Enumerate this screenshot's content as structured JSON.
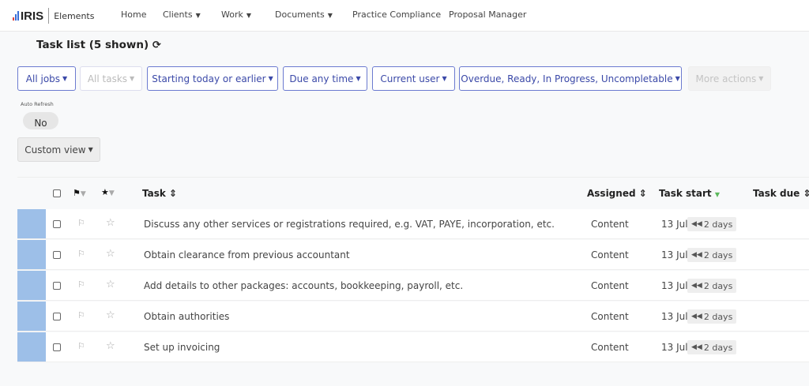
{
  "app": {
    "logo": "IRIS",
    "product": "Elements"
  },
  "nav": {
    "items": [
      {
        "label": "Home",
        "dropdown": false
      },
      {
        "label": "Clients",
        "dropdown": true
      },
      {
        "label": "Work",
        "dropdown": true
      },
      {
        "label": "Documents",
        "dropdown": true
      },
      {
        "label": "Practice Compliance",
        "dropdown": false
      },
      {
        "label": "Proposal Manager",
        "dropdown": false
      }
    ]
  },
  "page": {
    "title": "Task list (5 shown)"
  },
  "filters": [
    {
      "label": "All jobs",
      "state": "active"
    },
    {
      "label": "All tasks",
      "state": "disabled"
    },
    {
      "label": "Starting today or earlier",
      "state": "active"
    },
    {
      "label": "Due any time",
      "state": "active"
    },
    {
      "label": "Current user",
      "state": "active"
    },
    {
      "label": "Overdue, Ready, In Progress, Uncompletable",
      "state": "active"
    },
    {
      "label": "More actions",
      "state": "disabled"
    }
  ],
  "auto_refresh": {
    "label": "Auto Refresh",
    "value": "No"
  },
  "custom_view": {
    "label": "Custom view"
  },
  "table": {
    "columns": {
      "task": "Task",
      "assigned": "Assigned",
      "task_start": "Task start",
      "task_due": "Task due"
    },
    "rows": [
      {
        "task": "Discuss any other services or registrations required, e.g. VAT, PAYE, incorporation, etc.",
        "assigned": "Content",
        "task_start": "13 Jul",
        "badge": "2 days"
      },
      {
        "task": "Obtain clearance from previous accountant",
        "assigned": "Content",
        "task_start": "13 Jul",
        "badge": "2 days"
      },
      {
        "task": "Add details to other packages: accounts, bookkeeping, payroll, etc.",
        "assigned": "Content",
        "task_start": "13 Jul",
        "badge": "2 days"
      },
      {
        "task": "Obtain authorities",
        "assigned": "Content",
        "task_start": "13 Jul",
        "badge": "2 days"
      },
      {
        "task": "Set up invoicing",
        "assigned": "Content",
        "task_start": "13 Jul",
        "badge": "2 days"
      }
    ]
  },
  "colors": {
    "accent": "#3b49a8",
    "row_marker": "#9dbfe8",
    "sort_active": "#5cb85c"
  }
}
